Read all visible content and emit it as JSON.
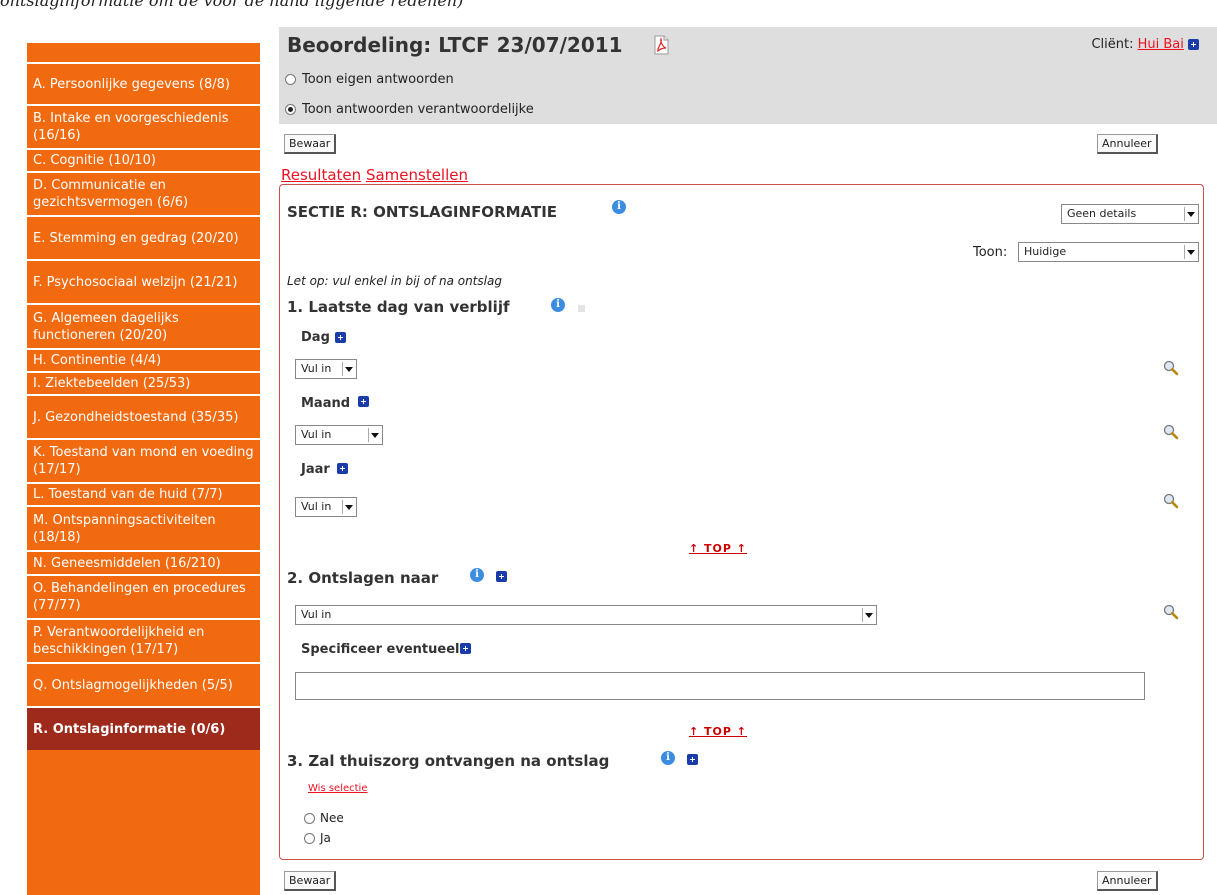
{
  "caption": "ontslaginformatie om de voor de hand liggende redenen)",
  "header": {
    "title": "Beoordeling: LTCF 23/07/2011",
    "client_label": "Cliënt:",
    "client_name": "Hui Bai"
  },
  "view_options": [
    {
      "label": "Toon eigen antwoorden",
      "checked": false
    },
    {
      "label": "Toon antwoorden verantwoordelijke",
      "checked": true
    }
  ],
  "buttons": {
    "save": "Bewaar",
    "cancel": "Annuleer"
  },
  "links": {
    "results": "Resultaten",
    "compose": "Samenstellen"
  },
  "sidebar": {
    "items": [
      {
        "label": "A. Persoonlijke gegevens (8/8)"
      },
      {
        "label": "B. Intake en voorgeschiedenis (16/16)"
      },
      {
        "label": "C. Cognitie (10/10)"
      },
      {
        "label": "D. Communicatie en gezichtsvermogen (6/6)"
      },
      {
        "label": "E. Stemming en gedrag (20/20)"
      },
      {
        "label": "F. Psychosociaal welzijn (21/21)"
      },
      {
        "label": "G. Algemeen dagelijks functioneren (20/20)"
      },
      {
        "label": "H. Continentie (4/4)"
      },
      {
        "label": "I. Ziektebeelden (25/53)"
      },
      {
        "label": "J. Gezondheidstoestand (35/35)"
      },
      {
        "label": "K. Toestand van mond en voeding (17/17)"
      },
      {
        "label": "L. Toestand van de huid (7/7)"
      },
      {
        "label": "M. Ontspanningsactiviteiten (18/18)"
      },
      {
        "label": "N. Geneesmiddelen (16/210)"
      },
      {
        "label": "O. Behandelingen en procedures (77/77)"
      },
      {
        "label": "P. Verantwoordelijkheid en beschikkingen (17/17)"
      },
      {
        "label": "Q. Ontslagmogelijkheden (5/5)"
      },
      {
        "label": "R. Ontslaginformatie (0/6)",
        "active": true
      }
    ]
  },
  "section": {
    "title": "SECTIE R: ONTSLAGINFORMATIE",
    "detail_select": "Geen details",
    "toon_label": "Toon:",
    "toon_select": "Huidige",
    "note": "Let op: vul enkel in bij of na ontslag",
    "top_link": "↑ TOP ↑",
    "q1": {
      "title": "1. Laatste dag van verblijf",
      "dag_label": "Dag",
      "dag_value": "Vul in",
      "maand_label": "Maand",
      "maand_value": "Vul in",
      "jaar_label": "Jaar",
      "jaar_value": "Vul in"
    },
    "q2": {
      "title": "2. Ontslagen naar",
      "value": "Vul in",
      "specify_label": "Specificeer eventueel",
      "specify_value": ""
    },
    "q3": {
      "title": "3. Zal thuiszorg ontvangen na ontslag",
      "clear": "Wis selectie",
      "options": [
        "Nee",
        "Ja"
      ]
    }
  }
}
